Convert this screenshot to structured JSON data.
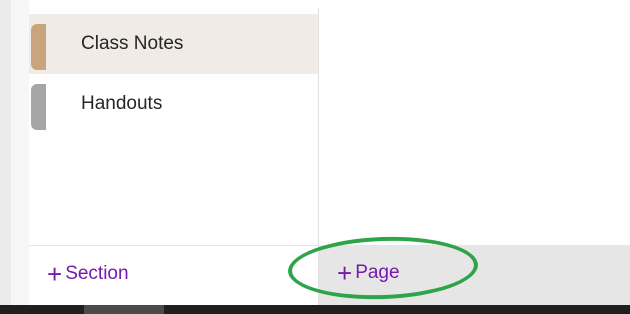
{
  "sections": [
    {
      "label": "Class Notes",
      "tab_color": "#c8a57c",
      "selected": true
    },
    {
      "label": "Handouts",
      "tab_color": "#a6a6a6",
      "selected": false
    }
  ],
  "footer": {
    "add_section_label": "Section",
    "add_page_label": "Page",
    "plus_glyph": "+"
  },
  "colors": {
    "accent": "#7719aa",
    "selected_bg": "#f0ebe6",
    "annotation": "#2ea34a"
  }
}
